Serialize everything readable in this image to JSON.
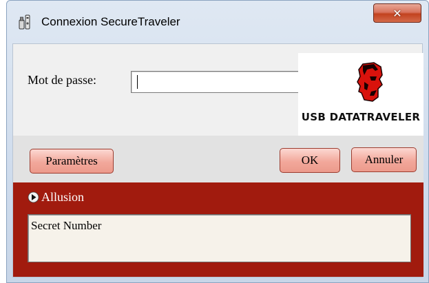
{
  "window": {
    "title": "Connexion SecureTraveler",
    "close_glyph": "✕",
    "app_icon": "usb-key-icon"
  },
  "login": {
    "password_label": "Mot de passe:",
    "password_value": "",
    "password_placeholder": ""
  },
  "logo": {
    "brand_text": "USB DATATRAVELER",
    "icon": "kingston-head-logo"
  },
  "buttons": {
    "settings_label": "Paramètres",
    "ok_label": "OK",
    "cancel_label": "Annuler"
  },
  "hint": {
    "toggle_label": "Allusion",
    "arrow_icon": "triangle-right-icon",
    "text": "Secret Number"
  },
  "colors": {
    "hint_panel": "#a11b0e",
    "button_fill": "#f2a89b",
    "close_button": "#c2421f"
  }
}
